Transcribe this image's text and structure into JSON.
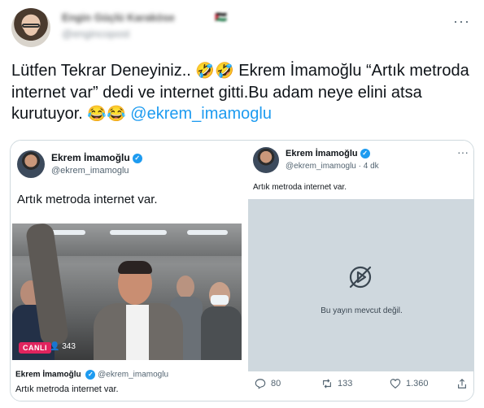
{
  "tweet": {
    "author_name_blurred": "Engin Güçlü Karaköse",
    "flag_emojis": "🇵🇸",
    "handle_blurred": "@engincopost",
    "text_part1": "Lütfen Tekrar Deneyiniz.. ",
    "emoji_laugh": "🤣🤣",
    "text_part2": " Ekrem İmamoğlu “Artık metroda internet var” dedi ve internet gitti.Bu adam neye elini atsa kurutuyor. ",
    "emoji_joy": "😂😂",
    "mention": "@ekrem_imamoglu",
    "more_icon": "···"
  },
  "left_screenshot": {
    "name": "Ekrem İmamoğlu",
    "handle": "@ekrem_imamoglu",
    "text": "Artık metroda internet var.",
    "live_badge": "CANLI",
    "viewers": "👤 343",
    "caption_name": "Ekrem İmamoğlu",
    "caption_handle": "@ekrem_imamoglu",
    "caption_text": "Artık metroda internet var."
  },
  "right_screenshot": {
    "name": "Ekrem İmamoğlu",
    "handle_time": "@ekrem_imamoglu · 4 dk",
    "text": "Artık metroda internet var.",
    "unavailable_text": "Bu yayın mevcut değil.",
    "more_icon": "···",
    "replies": "80",
    "retweets": "133",
    "likes": "1.360"
  },
  "colors": {
    "accent": "#1d9bf0",
    "live": "#e0245e",
    "muted": "#536471"
  }
}
